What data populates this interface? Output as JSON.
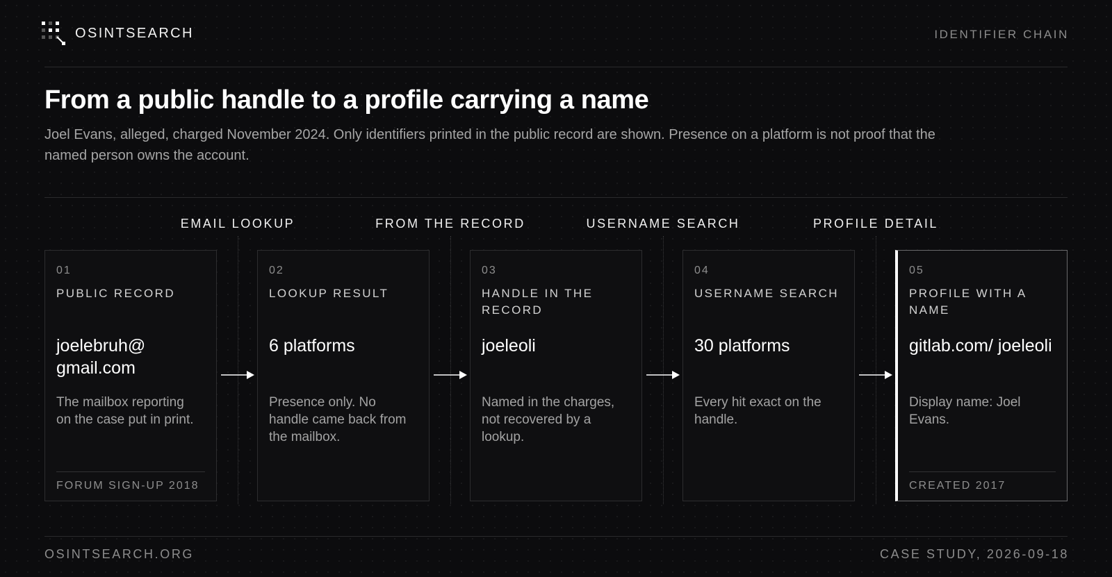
{
  "header": {
    "brand": "OSINTSEARCH",
    "tag": "IDENTIFIER CHAIN"
  },
  "hero": {
    "title": "From a public handle to a profile carrying a name",
    "subtitle": "Joel Evans, alleged, charged November 2024. Only identifiers printed in the public record are shown. Presence on a platform is not proof that the named person owns the account."
  },
  "stages": [
    {
      "label": "EMAIL LOOKUP"
    },
    {
      "label": "FROM THE RECORD"
    },
    {
      "label": "USERNAME SEARCH"
    },
    {
      "label": "PROFILE DETAIL"
    }
  ],
  "cards": [
    {
      "num": "01",
      "label": "PUBLIC RECORD",
      "value": "joelebruh@ gmail.com",
      "desc": "The mailbox reporting on the case put in print.",
      "meta": "FORUM SIGN-UP 2018"
    },
    {
      "num": "02",
      "label": "LOOKUP RESULT",
      "value": "6 platforms",
      "desc": "Presence only. No handle came back from the mailbox.",
      "meta": ""
    },
    {
      "num": "03",
      "label": "HANDLE IN THE RECORD",
      "value": "joeleoli",
      "desc": "Named in the charges, not recovered by a lookup.",
      "meta": ""
    },
    {
      "num": "04",
      "label": "USERNAME SEARCH",
      "value": "30 platforms",
      "desc": "Every hit exact on the handle.",
      "meta": ""
    },
    {
      "num": "05",
      "label": "PROFILE WITH A NAME",
      "value": "gitlab.com/ joeleoli",
      "desc": "Display name: Joel Evans.",
      "meta": "CREATED 2017"
    }
  ],
  "footer": {
    "site": "OSINTSEARCH.ORG",
    "case": "CASE STUDY, 2026-09-18"
  },
  "icons": {
    "logo": "dot-grid-logo-icon",
    "arrow": "arrow-right-icon"
  },
  "colors": {
    "background": "#0c0c0e",
    "card": "#0f0f11",
    "accent": "#ffffff",
    "muted": "#a3a3a3"
  }
}
